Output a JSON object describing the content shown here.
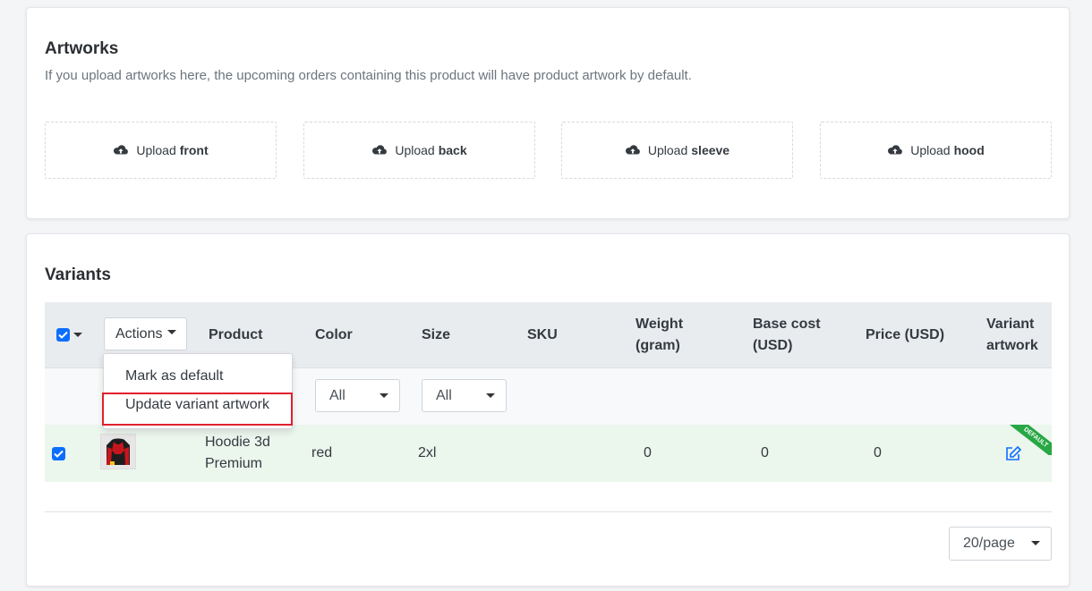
{
  "artworks": {
    "title": "Artworks",
    "subtitle": "If you upload artworks here, the upcoming orders containing this product will have product artwork by default.",
    "upload_prefix": "Upload",
    "uploads": [
      {
        "label": "front"
      },
      {
        "label": "back"
      },
      {
        "label": "sleeve"
      },
      {
        "label": "hood"
      }
    ]
  },
  "variants": {
    "title": "Variants",
    "actions_label": "Actions",
    "columns": {
      "product": "Product",
      "color": "Color",
      "size": "Size",
      "sku": "SKU",
      "weight_1": "Weight",
      "weight_2": "(gram)",
      "base_cost_1": "Base cost",
      "base_cost_2": "(USD)",
      "price": "Price (USD)",
      "variant_artwork_1": "Variant",
      "variant_artwork_2": "artwork"
    },
    "filters": {
      "color": "All",
      "size": "All"
    },
    "row": {
      "product_line1": "Hoodie 3d",
      "product_line2": "Premium",
      "color": "red",
      "size": "2xl",
      "sku": "",
      "weight": "0",
      "base_cost": "0",
      "price": "0",
      "badge": "DEFAULT",
      "checked": true
    },
    "per_page": "20/page"
  },
  "actions_menu": {
    "items": [
      "Mark as default",
      "Update variant artwork"
    ],
    "highlighted_item": "Update variant artwork"
  },
  "colors": {
    "accent": "#0d6efd",
    "row_selected": "#ebf6ed",
    "badge": "#28a745",
    "highlight": "#e0202d"
  }
}
